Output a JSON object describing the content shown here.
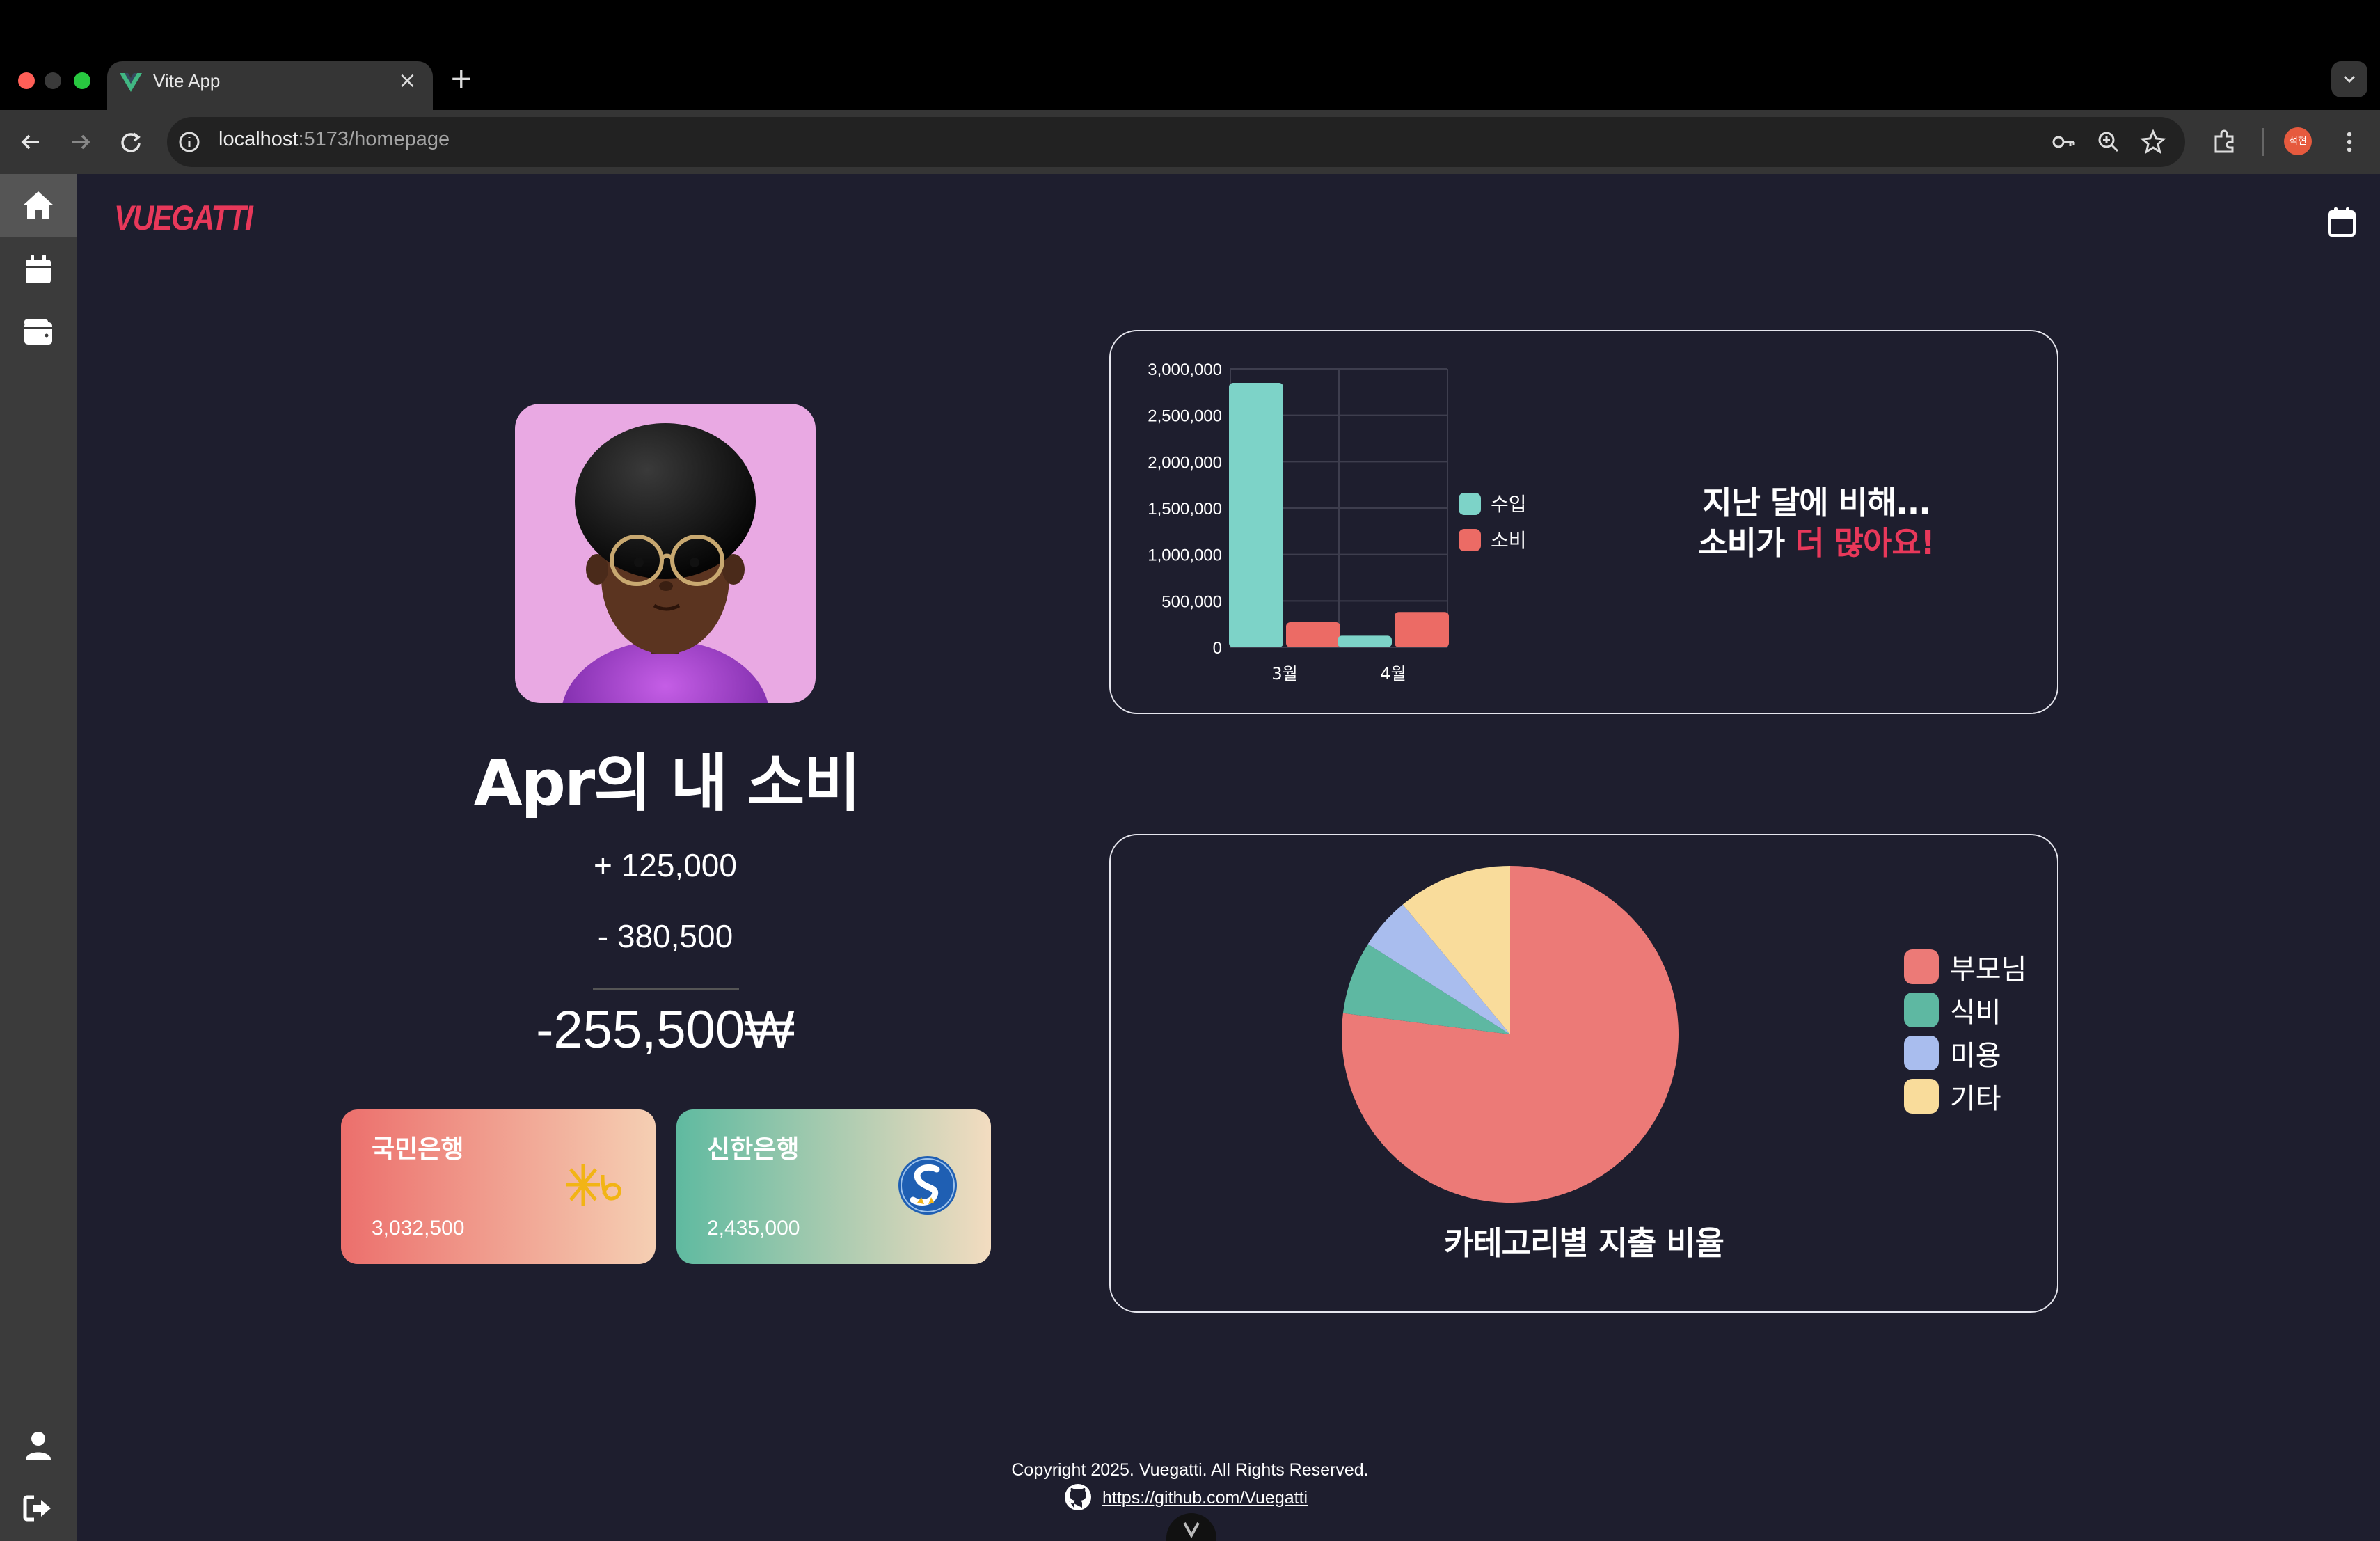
{
  "browser": {
    "tab_title": "Vite App",
    "url_host": "localhost",
    "url_rest": ":5173/homepage",
    "profile_badge": "석현"
  },
  "app": {
    "logo": "VUEGATTI",
    "page_title": "Apr의 내 소비",
    "income_line": "+ 125,000",
    "expense_line": "- 380,500",
    "total_line": "-255,500₩",
    "banks": [
      {
        "name": "국민은행",
        "amount": "3,032,500"
      },
      {
        "name": "신한은행",
        "amount": "2,435,000"
      }
    ],
    "message_line1": "지난 달에 비해...",
    "message_line2_prefix": "소비가 ",
    "message_line2_highlight": "더 많아요!",
    "pie_caption": "카테고리별 지출 비율",
    "footer_copyright": "Copyright 2025. Vuegatti. All Rights Reserved.",
    "footer_link": "https://github.com/Vuegatti"
  },
  "colors": {
    "accent": "#e8385a",
    "background": "#1e1e2e",
    "income": "#7dd3c8",
    "expense": "#ec6b65"
  },
  "icons": [
    "home-icon",
    "calendar-icon",
    "wallet-icon",
    "user-icon",
    "logout-icon",
    "github-icon"
  ],
  "chart_data": [
    {
      "type": "bar",
      "categories": [
        "3월",
        "4월"
      ],
      "series": [
        {
          "name": "수입",
          "values": [
            2850000,
            125000
          ],
          "color": "#7dd3c8"
        },
        {
          "name": "소비",
          "values": [
            270000,
            380500
          ],
          "color": "#ec6b65"
        }
      ],
      "ylim": [
        0,
        3000000
      ],
      "yticks": [
        "0",
        "500,000",
        "1,000,000",
        "1,500,000",
        "2,000,000",
        "2,500,000",
        "3,000,000"
      ],
      "grid": true,
      "legend": "right"
    },
    {
      "type": "pie",
      "title": "카테고리별 지출 비율",
      "labels": [
        "부모님",
        "식비",
        "미용",
        "기타"
      ],
      "values": [
        77,
        7,
        5,
        11
      ],
      "colors": [
        "#ec7a77",
        "#5eb8a2",
        "#a9bdee",
        "#f9dc9b"
      ],
      "legend": "right"
    }
  ]
}
